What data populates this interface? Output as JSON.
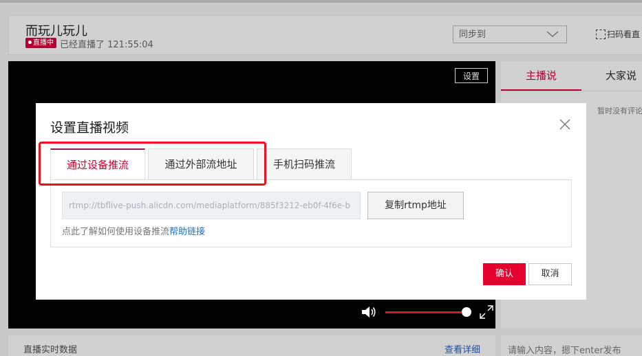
{
  "header": {
    "title": "而玩儿玩儿",
    "live_badge": "直播中",
    "live_duration": "已经直播了 121:55:04",
    "sync_select": "同步到",
    "scan_label": "扫码看直"
  },
  "video": {
    "settings_label": "设置",
    "volume_level": 0.95
  },
  "side_panel": {
    "tabs": [
      "主播说",
      "大家说"
    ],
    "empty_text": "暂时没有评论"
  },
  "bottom": {
    "realtime_label": "直播实时数据",
    "detail_link": "查看详细",
    "chat_placeholder": "请输入内容，摁下enter发布"
  },
  "modal": {
    "title": "设置直播视频",
    "tabs": [
      "通过设备推流",
      "通过外部流地址",
      "手机扫码推流"
    ],
    "active_tab": 0,
    "rtmp_placeholder": "rtmp://tbflive-push.alicdn.com/mediaplatform/885f3212-eb0f-4f6e-b",
    "copy_button": "复制rtmp地址",
    "help_text": "点此了解如何使用设备推流",
    "help_link": "帮助链接",
    "confirm": "确认",
    "cancel": "取消"
  },
  "colors": {
    "accent": "#e4002f",
    "tab_active": "#c8002c",
    "link": "#1f6fbf",
    "highlight": "#e3141b"
  }
}
